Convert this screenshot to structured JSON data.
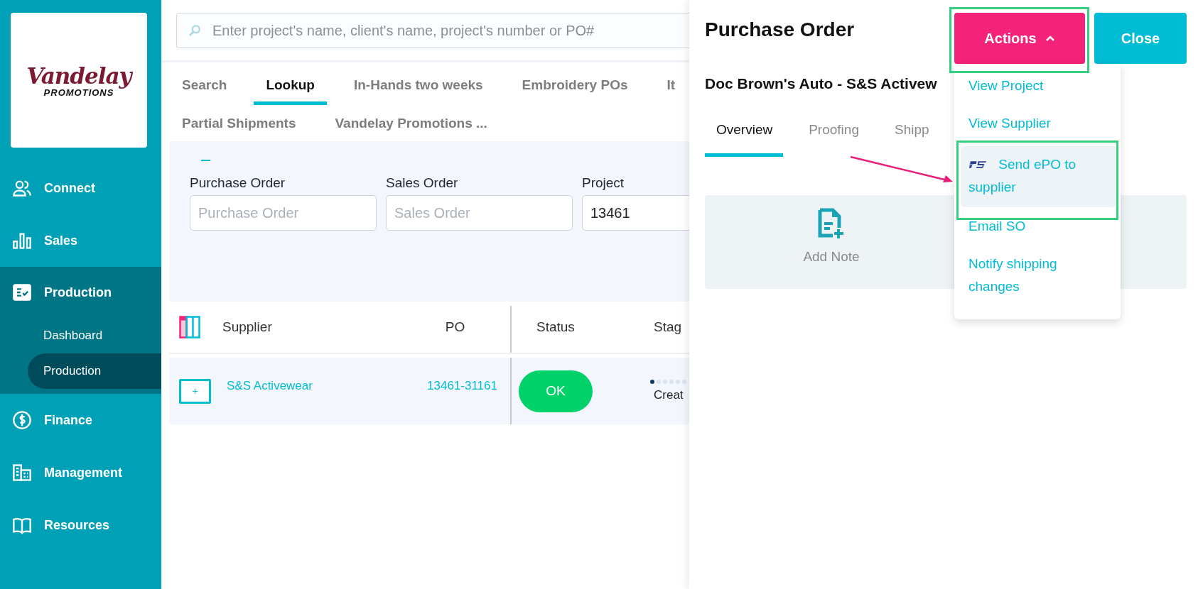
{
  "sidebar": {
    "logo": {
      "name": "Vandelay",
      "tagline": "PROMOTIONS"
    },
    "items": [
      {
        "label": "Connect",
        "selected": false
      },
      {
        "label": "Sales",
        "selected": false
      },
      {
        "label": "Production",
        "selected": true,
        "children": [
          {
            "label": "Dashboard",
            "selected": false
          },
          {
            "label": "Production",
            "selected": true
          }
        ]
      },
      {
        "label": "Finance",
        "selected": false
      },
      {
        "label": "Management",
        "selected": false
      },
      {
        "label": "Resources",
        "selected": false
      }
    ]
  },
  "search": {
    "placeholder": "Enter project's name, client's name, project's number or PO#"
  },
  "tab_rows": [
    {
      "tabs": [
        {
          "label": "Search",
          "selected": false
        },
        {
          "label": "Lookup",
          "selected": true
        },
        {
          "label": "In-Hands two weeks",
          "selected": false
        },
        {
          "label": "Embroidery POs",
          "selected": false
        },
        {
          "label": "It",
          "selected": false
        }
      ]
    },
    {
      "tabs": [
        {
          "label": "Partial Shipments",
          "selected": false
        },
        {
          "label": "Vandelay Promotions ...",
          "selected": false
        }
      ]
    }
  ],
  "filters": [
    {
      "label": "Purchase Order",
      "placeholder": "Purchase Order"
    },
    {
      "label": "Sales Order",
      "placeholder": "Sales Order"
    },
    {
      "label": "Project",
      "value": "13461"
    }
  ],
  "table": {
    "columns": [
      "Supplier",
      "PO",
      "Status",
      "Stag"
    ],
    "rows": [
      {
        "expand": "+",
        "supplier": "S&S Activewear",
        "po": "13461-31161",
        "status": "OK",
        "stage_steps": [
          {
            "done": true
          },
          {
            "done": false
          },
          {
            "done": false
          },
          {
            "done": false
          },
          {
            "done": false
          },
          {
            "done": false
          }
        ],
        "stage": "Creat"
      }
    ]
  },
  "panel": {
    "title": "Purchase Order",
    "actions": {
      "label": "Actions",
      "expanded": true
    },
    "close": "Close",
    "subtitle": "Doc Brown's Auto - S&S Activew",
    "tabs": [
      {
        "label": "Overview",
        "selected": true
      },
      {
        "label": "Proofing",
        "selected": false
      },
      {
        "label": "Shipp",
        "selected": false
      }
    ],
    "cards": [
      {
        "label": "Add Note"
      }
    ],
    "menu": [
      {
        "label": "View Project",
        "selected": false,
        "kind": "plain"
      },
      {
        "label": "View Supplier",
        "selected": false,
        "kind": "plain"
      },
      {
        "label": "Send ePO to supplier",
        "selected": true,
        "kind": "logo"
      },
      {
        "label": "Email SO",
        "selected": false,
        "kind": "plain"
      },
      {
        "label": "Notify shipping changes",
        "selected": false,
        "kind": "plain"
      }
    ]
  }
}
